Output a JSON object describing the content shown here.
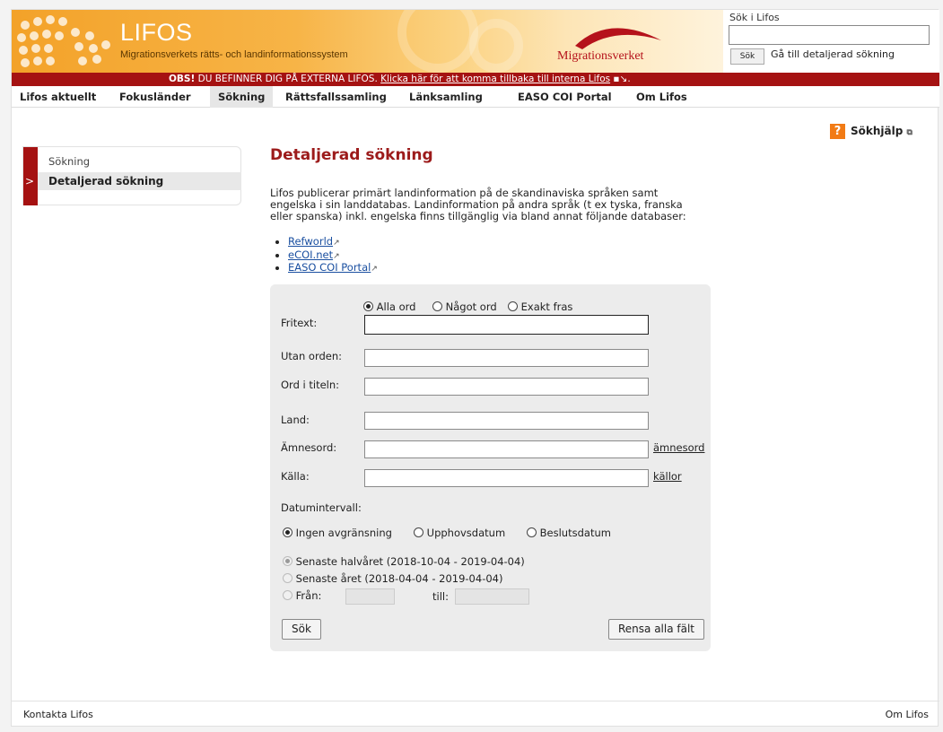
{
  "header": {
    "logo_title": "LIFOS",
    "logo_subtitle": "Migrationsverkets rätts- och landinformationssystem",
    "brand": "Migrationsverket",
    "search_label": "Sök i Lifos",
    "search_value": "",
    "search_button": "Sök",
    "advanced_link": "Gå till detaljerad sökning"
  },
  "notice": {
    "bold": "OBS!",
    "text": " DU BEFINNER DIG  PÅ EXTERNA LIFOS. ",
    "link": "Klicka här för att komma tillbaka till interna Lifos",
    "suffix": "."
  },
  "nav": [
    {
      "label": "Lifos aktuellt"
    },
    {
      "label": "Fokusländer"
    },
    {
      "label": "Sökning"
    },
    {
      "label": "Rättsfallssamling"
    },
    {
      "label": "Länksamling"
    },
    {
      "label": "EASO COI Portal"
    },
    {
      "label": "Om Lifos"
    }
  ],
  "help": {
    "label": "Sökhjälp"
  },
  "side": {
    "item1": "Sökning",
    "item2": "Detaljerad sökning"
  },
  "main": {
    "title": "Detaljerad sökning",
    "intro": "Lifos publicerar primärt landinformation på de skandinaviska språken samt engelska i sin landdatabas. Landinformation på andra språk (t ex tyska, franska eller spanska) inkl. engelska finns tillgänglig via bland annat följande databaser:",
    "databases": [
      "Refworld",
      "eCOI.net",
      "EASO COI Portal"
    ]
  },
  "form": {
    "match_options": [
      "Alla ord",
      "Något ord",
      "Exakt fras"
    ],
    "labels": {
      "fritext": "Fritext:",
      "utan": "Utan orden:",
      "titel": "Ord i titeln:",
      "land": "Land:",
      "amnesord": "Ämnesord:",
      "kalla": "Källa:",
      "datum": "Datumintervall:"
    },
    "amnesord_link": "ämnesord",
    "kallor_link": "källor",
    "date_options": [
      "Ingen avgränsning",
      "Upphovsdatum",
      "Beslutsdatum"
    ],
    "period_options": [
      "Senaste halvåret (2018-10-04 - 2019-04-04)",
      "Senaste året (2018-04-04 - 2019-04-04)"
    ],
    "from_label": "Från:",
    "to_label": "till:",
    "search_button": "Sök",
    "clear_button": "Rensa alla fält"
  },
  "footer": {
    "left": "Kontakta Lifos",
    "right": "Om Lifos"
  },
  "colors": {
    "brand_red": "#a51212",
    "title_red": "#9c1b1b",
    "accent_orange": "#f3a229",
    "link_blue": "#1a4fa0"
  }
}
